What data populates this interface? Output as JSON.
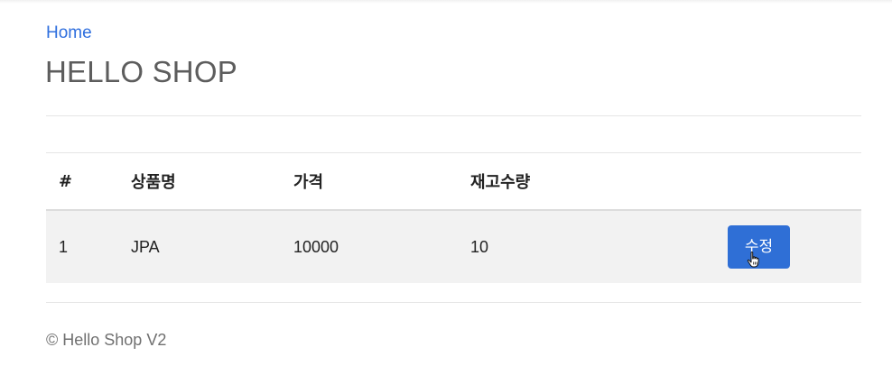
{
  "nav": {
    "home_label": "Home"
  },
  "header": {
    "title": "HELLO SHOP"
  },
  "table": {
    "columns": [
      "#",
      "상품명",
      "가격",
      "재고수량",
      ""
    ],
    "rows": [
      {
        "id": "1",
        "name": "JPA",
        "price": "10000",
        "stock": "10",
        "action_label": "수정"
      }
    ]
  },
  "footer": {
    "text": "© Hello Shop V2"
  },
  "colors": {
    "link": "#2f6fde",
    "primary_button": "#2f6fd6",
    "row_background": "#f2f2f2",
    "title": "#5d5d5d"
  },
  "icons": {
    "cursor": "hand-pointer-icon"
  }
}
